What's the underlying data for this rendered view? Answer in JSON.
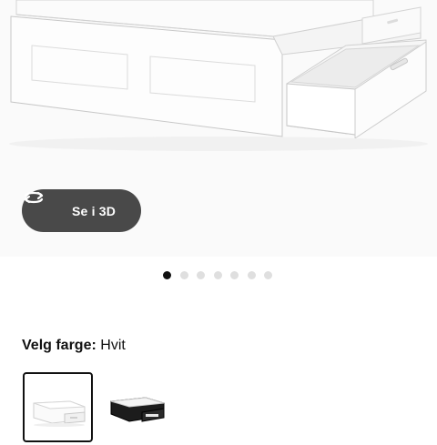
{
  "product": {
    "viewer_button": {
      "label": "Se i 3D",
      "icon": "rotate-3d-icon"
    },
    "gallery": {
      "total_images": 7,
      "active_index": 0
    }
  },
  "color_selector": {
    "label": "Velg farge:",
    "selected_value": "Hvit",
    "options": [
      {
        "name": "Hvit",
        "selected": true
      },
      {
        "name": "Svart",
        "selected": false
      }
    ]
  },
  "colors": {
    "button_bg": "#494949",
    "active_dot": "#111111",
    "inactive_dot": "#dfdfdf",
    "hero_bg": "#fafafa"
  }
}
